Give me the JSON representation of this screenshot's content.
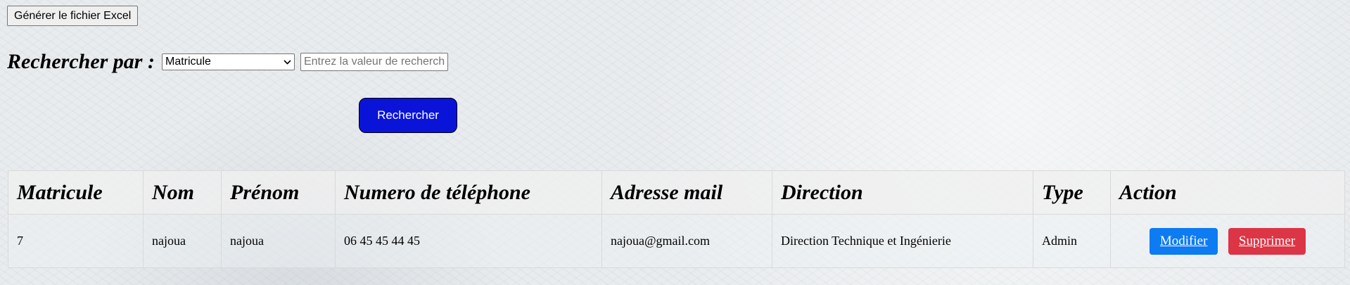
{
  "toolbar": {
    "excel_button_label": "Générer le fichier Excel"
  },
  "search": {
    "label": "Rechercher par :",
    "select_value": "Matricule",
    "input_placeholder": "Entrez la valeur de recherche",
    "button_label": "Rechercher"
  },
  "table": {
    "headers": [
      "Matricule",
      "Nom",
      "Prénom",
      "Numero de téléphone",
      "Adresse mail",
      "Direction",
      "Type",
      "Action"
    ],
    "rows": [
      {
        "matricule": "7",
        "nom": "najoua",
        "prenom": "najoua",
        "telephone": "06 45 45 44 45",
        "email": "najoua@gmail.com",
        "direction": "Direction Technique et Ingénierie",
        "type": "Admin",
        "edit_label": "Modifier",
        "delete_label": "Supprimer"
      }
    ]
  },
  "colors": {
    "search_button_bg": "#0a14d8",
    "edit_button_bg": "#0d7bf2",
    "delete_button_bg": "#dc3545"
  },
  "icons": {
    "select_arrow": "chevron-down-icon"
  }
}
